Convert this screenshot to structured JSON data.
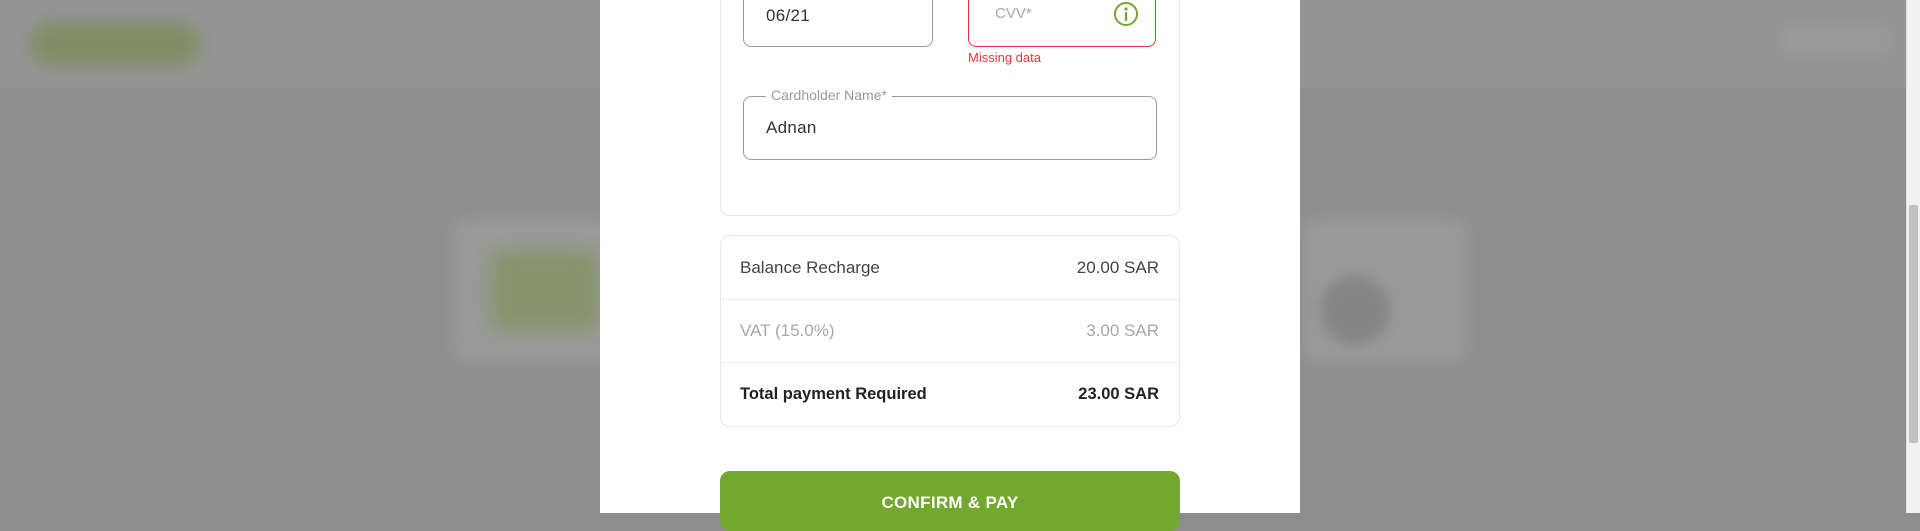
{
  "payment_form": {
    "expiry": {
      "value": "06/21"
    },
    "cvv": {
      "placeholder": "CVV*",
      "error": "Missing data",
      "icon": "info-icon"
    },
    "cardholder": {
      "label": "Cardholder Name*",
      "value": "Adnan"
    }
  },
  "summary": {
    "rows": [
      {
        "label": "Balance Recharge",
        "amount": "20.00 SAR"
      },
      {
        "label": "VAT (15.0%)",
        "amount": "3.00 SAR"
      },
      {
        "label": "Total payment Required",
        "amount": "23.00 SAR"
      }
    ]
  },
  "actions": {
    "confirm_label": "CONFIRM & PAY"
  },
  "colors": {
    "accent": "#72a82e",
    "error": "#e1363c",
    "border": "#9a9a9a"
  }
}
